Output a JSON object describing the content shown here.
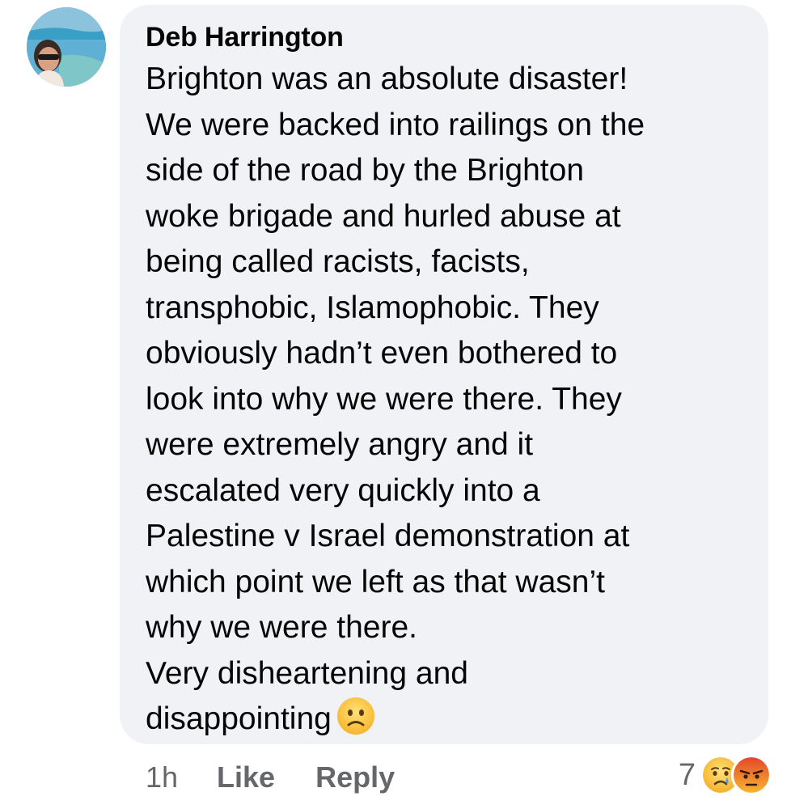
{
  "comment": {
    "author": "Deb Harrington",
    "lines": [
      "Brighton was an absolute disaster!",
      "We were backed into railings on the",
      "side of the road by the Brighton",
      "woke brigade and hurled abuse at",
      "being called racists, facists,",
      "transphobic, Islamophobic. They",
      "obviously hadn’t even bothered to",
      "look into why we were there. They",
      "were extremely angry and it",
      "escalated very quickly into a",
      "Palestine v Israel demonstration at",
      "which point we left as that wasn’t",
      "why we were there.",
      "Very disheartening and",
      "disappointing"
    ],
    "trailing_emoji": "slightly-frowning-face-emoji"
  },
  "footer": {
    "timestamp": "1h",
    "like_label": "Like",
    "reply_label": "Reply"
  },
  "reactions": {
    "count": "7",
    "icons": [
      "sad-reaction-icon",
      "angry-reaction-icon"
    ]
  },
  "colors": {
    "bubble_bg": "#f0f2f5",
    "text": "#050505",
    "meta_text": "#65676b"
  }
}
